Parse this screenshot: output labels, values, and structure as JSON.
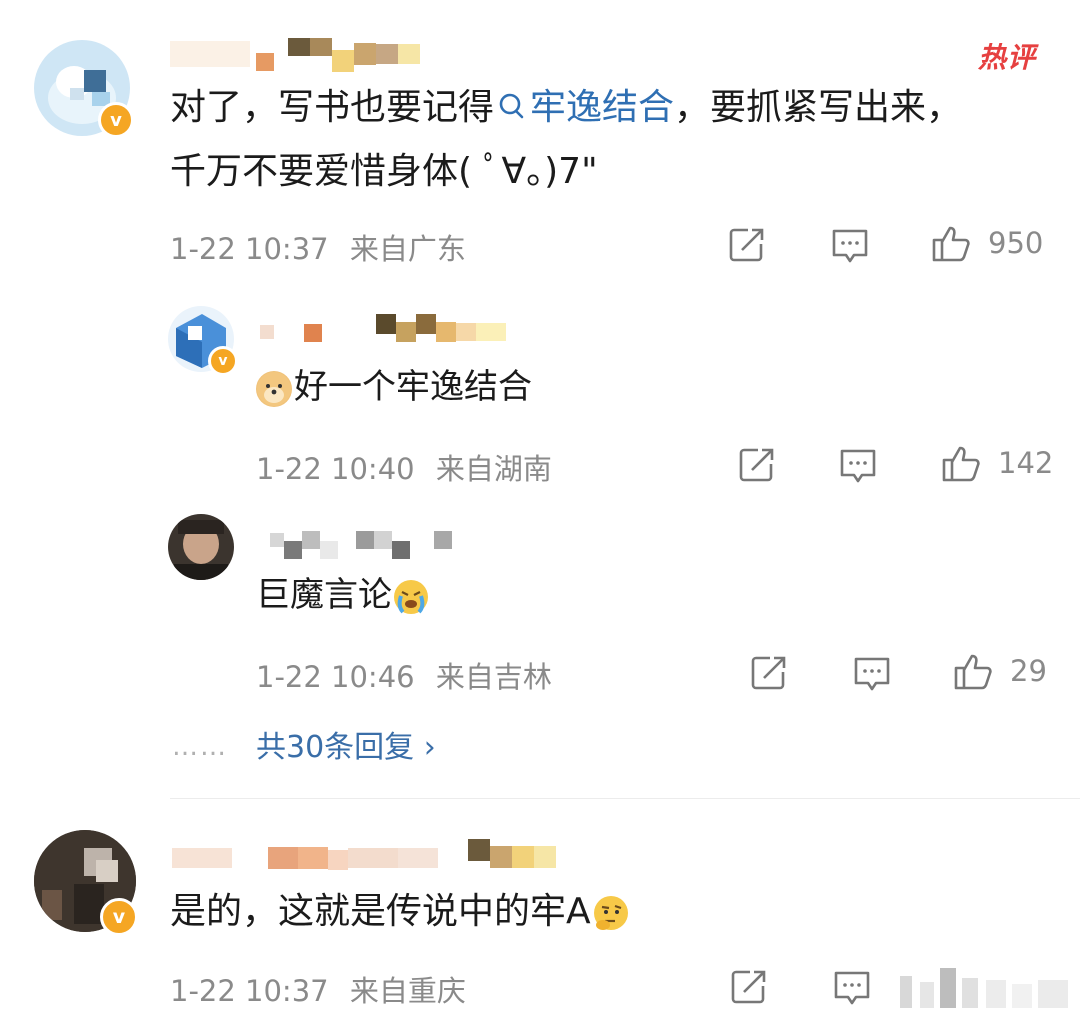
{
  "comments": [
    {
      "text_before_topic": "对了，写书也要记得",
      "topic_search_icon": "search-icon",
      "topic": "牢逸结合",
      "text_after_topic": "，要抓紧写出来，",
      "line2": "千万不要爱惜身体( ﾟ∀。)7\"",
      "time": "1-22 10:37",
      "location": "来自广东",
      "like_count": "950",
      "badge": "热评"
    },
    {
      "text": "好一个牢逸结合",
      "emoji": "doge-emoji",
      "time": "1-22 10:40",
      "location": "来自湖南",
      "like_count": "142"
    },
    {
      "text": "巨魔言论",
      "emoji": "crying-emoji",
      "time": "1-22 10:46",
      "location": "来自吉林",
      "like_count": "29"
    },
    {
      "text": "是的，这就是传说中的牢A",
      "emoji": "thinking-emoji",
      "time": "1-22 10:37",
      "location": "来自重庆"
    }
  ],
  "more_replies": {
    "dots": "……",
    "label": "共30条回复 ›"
  },
  "colors": {
    "accent_link": "#2f6fb3",
    "meta_gray": "#8a8a8a",
    "badge_red": "#e64040",
    "verify_orange": "#f5a623"
  }
}
